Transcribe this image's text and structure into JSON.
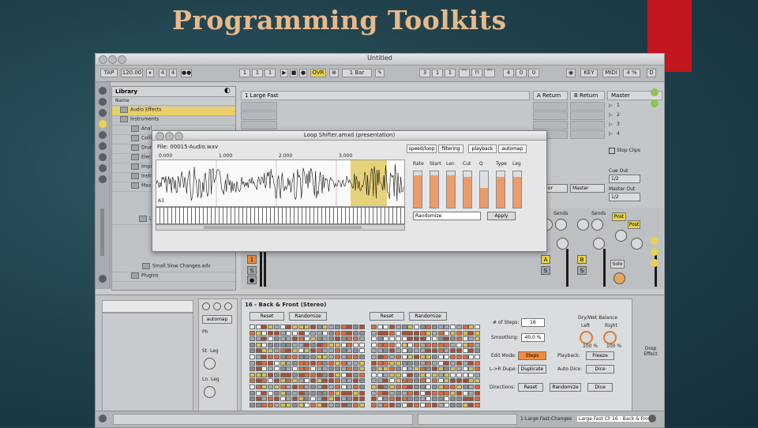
{
  "slide": {
    "title": "Programming Toolkits",
    "accent_color": "#c3161f",
    "title_color": "#e8b98a"
  },
  "window": {
    "title": "Untitled"
  },
  "transport": {
    "tap": "TAP",
    "tempo": "120.00",
    "sig_num": "4",
    "sig_den": "4",
    "ovr": "OVR",
    "bar": "1",
    "beat": "1",
    "sixteenth": "1",
    "quantize": "1 Bar",
    "pos_bar": "3",
    "pos_beat": "1",
    "pos_sixteenth": "1",
    "loop_bar": "4",
    "loop_beat": "0",
    "loop_sixteenth": "0",
    "key": "KEY",
    "midi": "MIDI",
    "cpu": "4 %",
    "d_button": "D"
  },
  "browser": {
    "title": "Library",
    "column": "Name",
    "items": [
      {
        "label": "Audio Effects",
        "selected": true
      },
      {
        "label": "Instruments",
        "selected": false
      },
      {
        "label": "Anal",
        "selected": false
      },
      {
        "label": "Colli",
        "selected": false
      },
      {
        "label": "Drum",
        "selected": false
      },
      {
        "label": "Elect",
        "selected": false
      },
      {
        "label": "Impu",
        "selected": false
      },
      {
        "label": "Instr",
        "selected": false
      },
      {
        "label": "Max",
        "selected": false
      },
      {
        "label": "Lo",
        "selected": false
      },
      {
        "label": "Small Slow Changes.adv",
        "selected": false
      },
      {
        "label": "Plugins",
        "selected": false
      }
    ]
  },
  "tracks": {
    "headers": [
      "1 Large Fast",
      "A Return",
      "B Return",
      "Master"
    ],
    "master_scenes": [
      "1",
      "2",
      "3",
      "4"
    ],
    "stop_clips": "Stop Clips",
    "cue_out": "Cue Out",
    "cue_out_value": "1/2",
    "master_out": "Master Out",
    "master_out_value": "1/2",
    "sends_label": "Sends",
    "post": "Post",
    "solo": "Solo",
    "track_num": "1",
    "return_a": "A",
    "return_b": "B",
    "s_button": "S",
    "master_in": "Master"
  },
  "popup": {
    "title": "Loop Shifter.amxd (presentation)",
    "file": "File: 00015-Audio.wav",
    "ruler": [
      "0.000",
      "1.000",
      "2.000",
      "3.000"
    ],
    "note": "A3",
    "tabs": [
      "speed/loop",
      "filtering",
      "playback",
      "automap"
    ],
    "param_labels": [
      "Rate",
      "Start",
      "Len",
      "Cut",
      "Q",
      "Type",
      "Leg"
    ],
    "param_levels": [
      0.9,
      0.9,
      0.9,
      0.85,
      0.55,
      0.85,
      0.85
    ],
    "preset_value": "Randomize",
    "apply": "Apply"
  },
  "device": {
    "title": "16 - Back & Front (Stereo)",
    "automap": "automap",
    "side_labels": [
      "Ph",
      "St. Leg",
      "Ln. Leg"
    ],
    "reset_buttons": [
      "Reset",
      "Reset"
    ],
    "randomize_buttons": [
      "Randomize",
      "Randomize"
    ],
    "num_steps_label": "# of Steps:",
    "num_steps_value": "16",
    "smoothing_label": "Smoothing:",
    "smoothing_value": "40.0 %",
    "edit_mode_label": "Edit Mode:",
    "edit_mode_value": "Steps",
    "playback_label": "Playback:",
    "playback_value": "Freeze",
    "lr_dupe_label": "L->R Dupe:",
    "lr_dupe_value": "Duplicate",
    "auto_dice_label": "Auto Dice:",
    "auto_dice_value": "Dice",
    "directions_label": "Directions:",
    "directions_reset": "Reset",
    "directions_randomize": "Randomize",
    "directions_dice": "Dice",
    "dry_wet": "Dry/Wet Balance",
    "left": "Left",
    "right": "Right",
    "left_value": "100 %",
    "right_value": "100 %",
    "side_right": "Drop Effect"
  },
  "bottom": {
    "clip1": "1-Large Fast-Changes",
    "clip2": "Large Fast Chan",
    "clip3": "16 - Back & Fron"
  }
}
